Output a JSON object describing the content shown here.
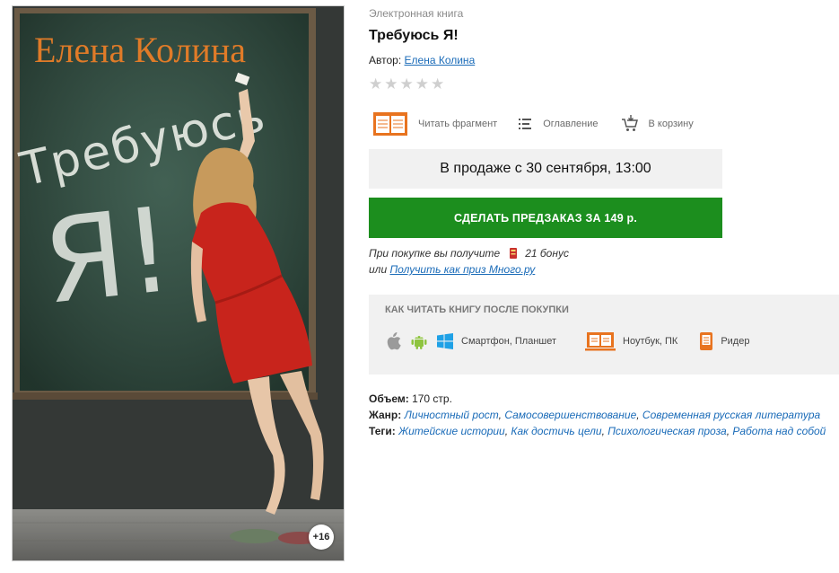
{
  "cover": {
    "author_text": "Елена Колина",
    "title_word_1": "Требуюсь",
    "title_word_2": "Я!",
    "age_rating": "+16"
  },
  "book": {
    "type": "Электронная книга",
    "title": "Требуюсь Я!",
    "author_label": "Автор:",
    "author": "Елена Колина",
    "rating_stars": 0,
    "rating_max": 5
  },
  "actions": {
    "read_fragment": "Читать фрагмент",
    "toc": "Оглавление",
    "to_cart": "В корзину"
  },
  "sale": {
    "availability": "В продаже с 30 сентября, 13:00",
    "preorder_button": "СДЕЛАТЬ ПРЕДЗАКАЗ ЗА 149 р."
  },
  "bonus": {
    "prefix": "При покупке вы получите",
    "amount": "21 бонус",
    "or": "или",
    "prize_link": "Получить как приз Много.ру"
  },
  "howto": {
    "title": "КАК ЧИТАТЬ КНИГУ ПОСЛЕ ПОКУПКИ",
    "phone": "Смартфон, Планшет",
    "laptop": "Ноутбук, ПК",
    "reader": "Ридер"
  },
  "meta": {
    "volume_label": "Объем:",
    "volume": "170 стр.",
    "genre_label": "Жанр:",
    "genres": [
      "Личностный рост",
      "Самосовершенствование",
      "Современная русская литература"
    ],
    "tags_label": "Теги:",
    "tags": [
      "Житейские истории",
      "Как достичь цели",
      "Психологическая проза",
      "Работа над собой"
    ]
  },
  "colors": {
    "accent_green": "#1c8e1e",
    "link_blue": "#1a6bb8",
    "icon_orange": "#e8731f",
    "android_green": "#8ec43f",
    "windows_blue": "#1fa1e6",
    "cover_author_orange": "#e07b28"
  }
}
